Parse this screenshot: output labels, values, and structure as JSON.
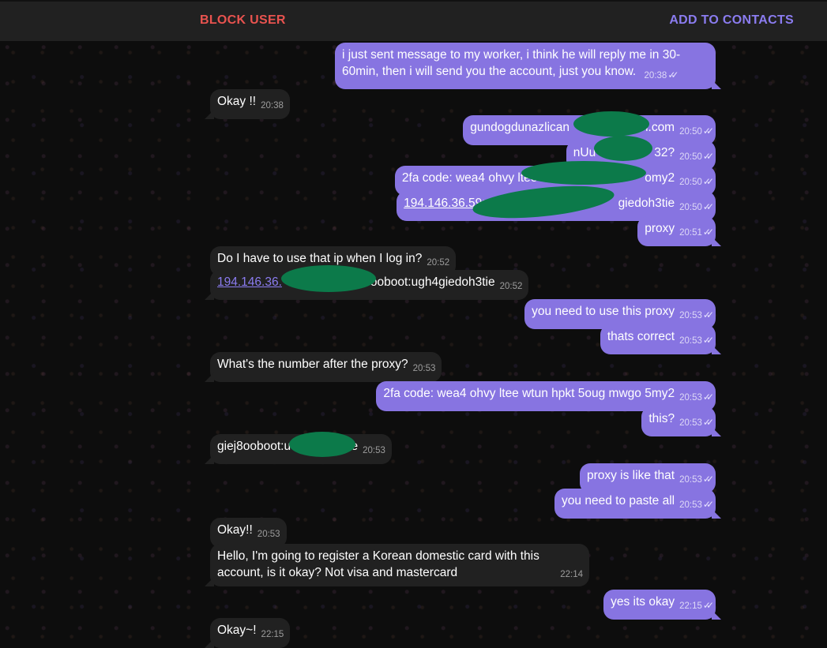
{
  "header": {
    "block_label": "BLOCK USER",
    "add_label": "ADD TO CONTACTS"
  },
  "colors": {
    "accent": "#8774e1",
    "danger": "#e9534f",
    "incoming": "#212121",
    "redaction": "#0c7a4a"
  },
  "icons": {
    "read_receipt": "double-check-icon"
  },
  "messages": [
    {
      "dir": "out",
      "text": "i just sent message to my worker, i think he will reply me in 30-60min, then i will send you the account, just you know.",
      "time": "20:38"
    },
    {
      "dir": "in",
      "text": "Okay !!",
      "time": "20:38"
    },
    {
      "dir": "out",
      "text": "gundogdunazlican",
      "text2": "l.com",
      "time": "20:50"
    },
    {
      "dir": "out",
      "text": "nUu",
      "text2": "32?",
      "time": "20:50"
    },
    {
      "dir": "out",
      "text": "2fa code: wea4 ohvy ltee wt",
      "text2": "omy2",
      "time": "20:50"
    },
    {
      "dir": "out",
      "text": "194.146.36.59:",
      "text2": "giedoh3tie",
      "time": "20:50"
    },
    {
      "dir": "out",
      "text": "proxy",
      "time": "20:51"
    },
    {
      "dir": "in",
      "text": "Do I have to use that ip when I log in?",
      "time": "20:52"
    },
    {
      "dir": "in",
      "text": "194.146.36.",
      "text2": "ooboot:ugh4giedoh3tie",
      "time": "20:52"
    },
    {
      "dir": "out",
      "text": "you need to use this proxy",
      "time": "20:53"
    },
    {
      "dir": "out",
      "text": "thats correct",
      "time": "20:53"
    },
    {
      "dir": "in",
      "text": "What's the number after the proxy?",
      "time": "20:53"
    },
    {
      "dir": "out",
      "text": "2fa code: wea4 ohvy ltee wtun hpkt 5oug mwgo 5my2",
      "time": "20:53"
    },
    {
      "dir": "out",
      "text": "this?",
      "time": "20:53"
    },
    {
      "dir": "in",
      "text": "giej8ooboot:u",
      "text2": "3tie",
      "time": "20:53"
    },
    {
      "dir": "out",
      "text": "proxy is like that",
      "time": "20:53"
    },
    {
      "dir": "out",
      "text": "you need to paste all",
      "time": "20:53"
    },
    {
      "dir": "in",
      "text": "Okay!!",
      "time": "20:53"
    },
    {
      "dir": "in",
      "text": "Hello, I'm going to register a Korean domestic card with this account, is it okay? Not visa and mastercard",
      "time": "22:14"
    },
    {
      "dir": "out",
      "text": "yes its okay",
      "time": "22:15"
    },
    {
      "dir": "in",
      "text": "Okay~!",
      "time": "22:15"
    }
  ]
}
